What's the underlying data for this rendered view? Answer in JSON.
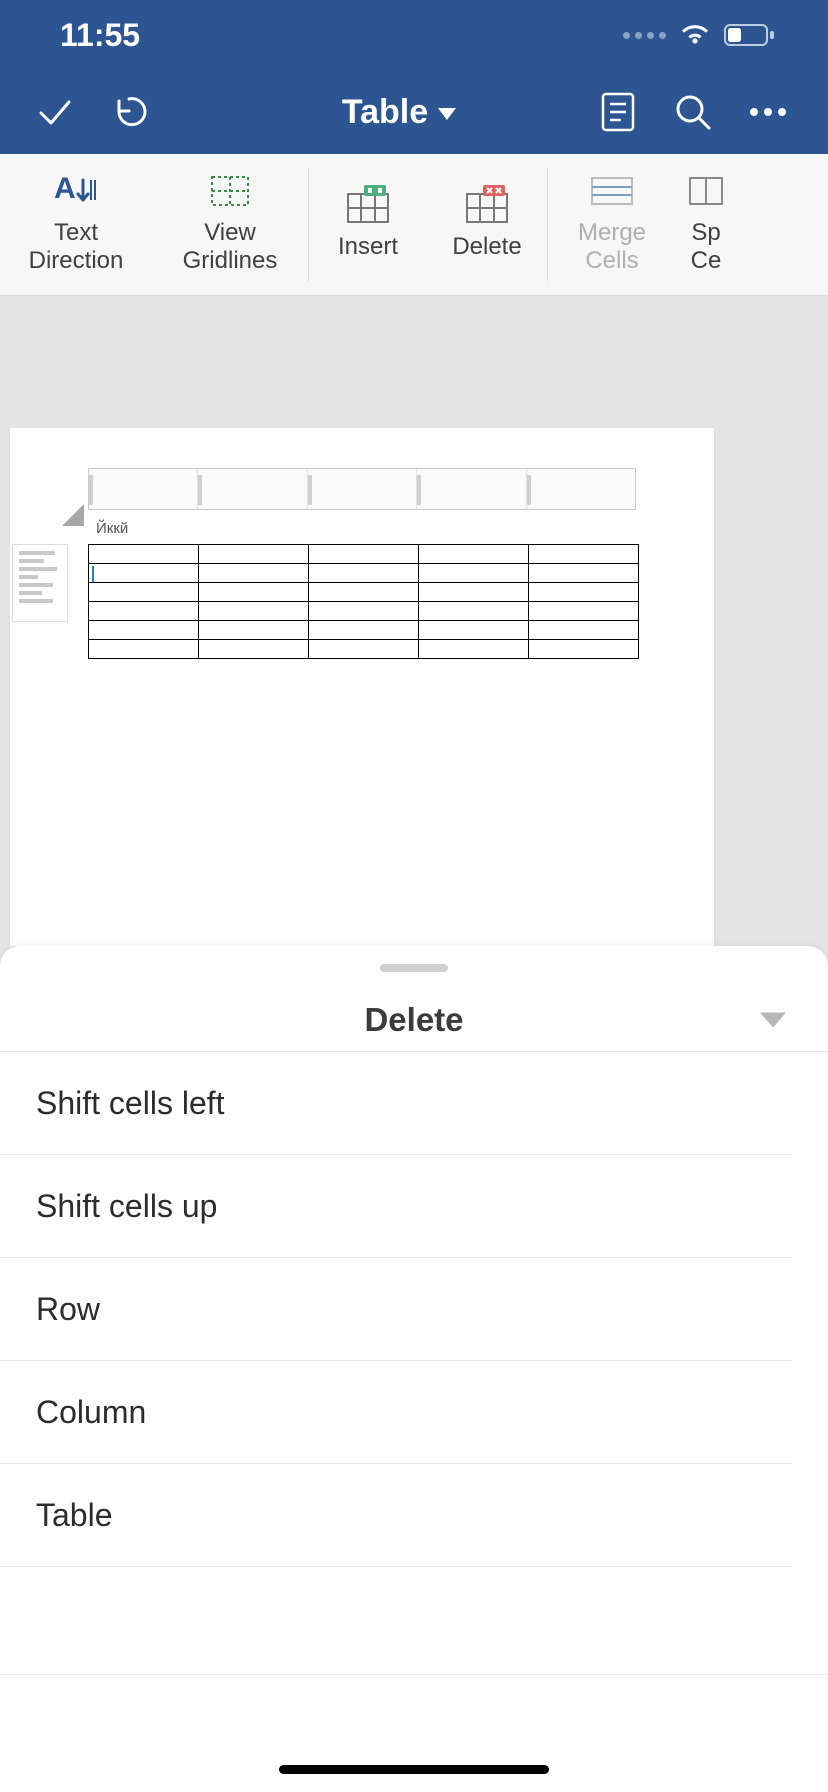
{
  "status_bar": {
    "time": "11:55"
  },
  "header": {
    "title": "Table"
  },
  "ribbon": {
    "text_direction": "Text\nDirection",
    "view_gridlines": "View\nGridlines",
    "insert": "Insert",
    "delete": "Delete",
    "merge_cells": "Merge\nCells",
    "split_cells": "Sp\nCe"
  },
  "document": {
    "label": "Йккй"
  },
  "sheet": {
    "title": "Delete",
    "options": [
      "Shift cells left",
      "Shift cells up",
      "Row",
      "Column",
      "Table"
    ]
  }
}
